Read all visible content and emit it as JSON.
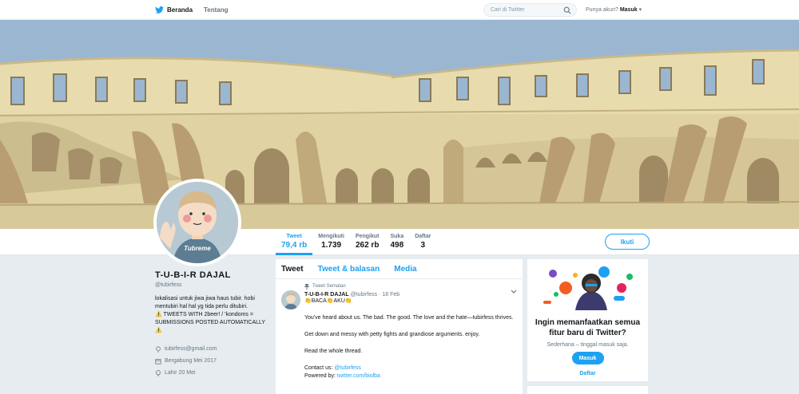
{
  "nav": {
    "home": "Beranda",
    "about": "Tentang",
    "search_placeholder": "Cari di Twitter",
    "account_prompt": "Punya akun?",
    "login": "Masuk"
  },
  "stats": [
    {
      "label": "Tweet",
      "value": "79,4 rb"
    },
    {
      "label": "Mengikuti",
      "value": "1.739"
    },
    {
      "label": "Pengikut",
      "value": "262 rb"
    },
    {
      "label": "Suka",
      "value": "498"
    },
    {
      "label": "Daftar",
      "value": "3"
    }
  ],
  "follow_label": "Ikuti",
  "avatar_caption": "Tubreme",
  "profile": {
    "name": "T-U-B-I-R DAJAL",
    "handle": "@tubirfess",
    "bio_line1": "lokalisasi untuk jiwa jiwa haus tubir. hobi mentubiri hal hal yg tida perlu ditubiri.",
    "bio_line2": "⚠️ TWEETS WITH 2beer! / 'kondoms = SUBMISSIONS POSTED AUTOMATICALLY ⚠️",
    "email": "tubirfess@gmail.com",
    "joined": "Bergabung Mei 2017",
    "born": "Lahir 20 Mei"
  },
  "tabs": [
    "Tweet",
    "Tweet & balasan",
    "Media"
  ],
  "tweet": {
    "pinned_label": "Tweet Sematan",
    "author_name": "T-U-B-I-R DAJAL",
    "author_handle": "@tubirfess",
    "date": "· 18 Feb",
    "line1": "👏BACA👏AKU👏",
    "p1": "You've heard about us. The bad. The good. The love and the hate—tubirfess thrives.",
    "p2": "Get down and messy with petty fights and grandiose arguments. enjoy.",
    "p3": "Read the whole thread.",
    "contact_label": "Contact us:",
    "contact_link": "@tubirfess",
    "powered_label": "Powered by:",
    "powered_link": "twitter.com/biolba"
  },
  "card": {
    "title": "Ingin memanfaatkan semua fitur baru di Twitter?",
    "subtitle": "Sederhana – tinggal masuk saja.",
    "login_button": "Masuk",
    "signup_link": "Daftar"
  },
  "colors": {
    "accent": "#1da1f2",
    "background": "#e6ecf0",
    "banner_sky": "#9bb6d1",
    "banner_stone": "#e9dcae"
  }
}
